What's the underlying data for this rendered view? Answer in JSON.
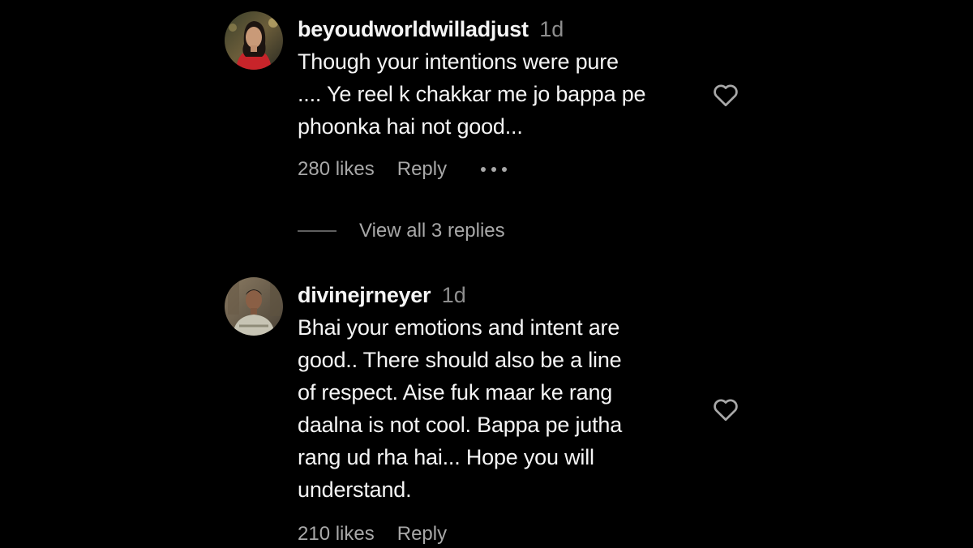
{
  "comments": [
    {
      "username": "beyoudworldwilladjust",
      "time": "1d",
      "text_lines": [
        "Though your intentions were pure",
        ".... Ye reel k chakkar me jo bappa pe",
        "phoonka hai not good..."
      ],
      "likes": "280 likes",
      "reply_label": "Reply",
      "icons": {
        "avatar": "user-avatar-photo",
        "like": "heart-outline-icon",
        "more": "more-options-icon"
      }
    },
    {
      "username": "divinejrneyer",
      "time": "1d",
      "text_lines": [
        "Bhai your emotions and intent are",
        "good.. There should also be a line",
        "of respect. Aise fuk maar ke rang",
        "daalna is not cool. Bappa pe jutha",
        "rang ud rha hai... Hope you will",
        "understand."
      ],
      "likes": "210 likes",
      "reply_label": "Reply",
      "icons": {
        "avatar": "user-avatar-photo",
        "like": "heart-outline-icon"
      }
    }
  ],
  "view_replies": "View all 3 replies",
  "colors": {
    "background": "#000000",
    "primary_text": "#f5f5f5",
    "secondary_text": "#a8a8a8",
    "timestamp": "#8e8e8e"
  }
}
